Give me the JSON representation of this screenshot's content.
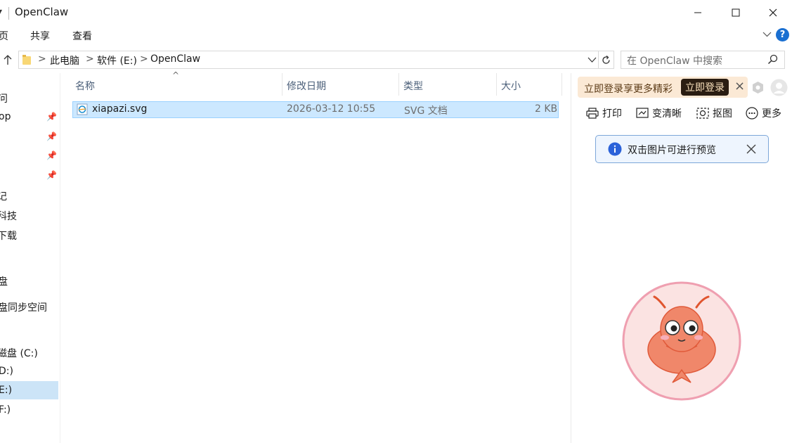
{
  "window": {
    "title": "OpenClaw",
    "title_arrow": "▾",
    "controls": {
      "minimize_icon": "minimize-icon",
      "maximize_icon": "maximize-icon",
      "close_icon": "close-icon"
    }
  },
  "ribbon": {
    "tabs": [
      "页",
      "共享",
      "查看"
    ],
    "help_label": "?"
  },
  "address": {
    "crumbs": [
      "此电脑",
      "软件 (E:)",
      "OpenClaw"
    ],
    "separator": ">",
    "search_placeholder": "在 OpenClaw 中搜索"
  },
  "nav": {
    "items": [
      {
        "label": "问",
        "pinned": false
      },
      {
        "label": "op",
        "pinned": true
      },
      {
        "label": "",
        "pinned": true
      },
      {
        "label": "",
        "pinned": true
      },
      {
        "label": "",
        "pinned": true
      },
      {
        "label": "记",
        "pinned": false
      },
      {
        "label": "科技",
        "pinned": false
      },
      {
        "label": "下载",
        "pinned": false
      },
      {
        "label": "盘",
        "pinned": false
      },
      {
        "label": "盘同步空间",
        "pinned": false
      },
      {
        "label": "磁盘 (C:)",
        "pinned": false
      },
      {
        "label": "D:)",
        "pinned": false
      },
      {
        "label": "E:)",
        "pinned": false,
        "selected": true
      },
      {
        "label": "F:)",
        "pinned": false
      }
    ]
  },
  "file_list": {
    "columns": [
      "名称",
      "修改日期",
      "类型",
      "大小"
    ],
    "sort_indicator": "^",
    "rows": [
      {
        "name": "xiapazi.svg",
        "modified": "2026-03-12 10:55",
        "type": "SVG 文档",
        "size": "2 KB",
        "selected": true
      }
    ]
  },
  "preview": {
    "promo_text": "立即登录享更多精彩",
    "promo_button": "立即登录",
    "promo_close": "×",
    "toolbar": [
      {
        "label": "打印",
        "icon": "printer-icon"
      },
      {
        "label": "变清晰",
        "icon": "enhance-icon"
      },
      {
        "label": "抠图",
        "icon": "cutout-icon"
      },
      {
        "label": "更多",
        "icon": "more-icon"
      }
    ],
    "hint_text": "双击图片可进行预览",
    "hint_icon": "info-icon",
    "image": "shrimp-mascot-image"
  },
  "colors": {
    "selection": "#cce8ff",
    "nav_selection": "#cce4f7",
    "accent": "#1a6fd1",
    "promo_bg": "#fbe9d5",
    "mascot": "#f0876a"
  }
}
